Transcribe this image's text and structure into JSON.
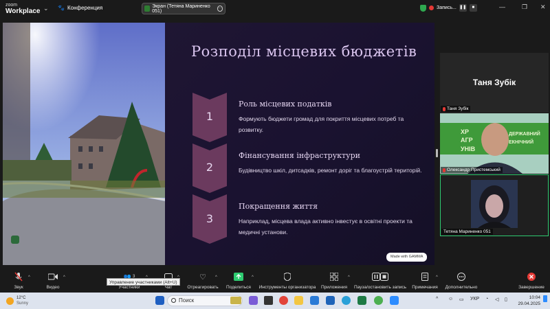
{
  "app": {
    "logo_line1": "zoom",
    "logo_line2": "Workplace",
    "meeting_label": "Конференция"
  },
  "screen_share": {
    "label": "Экран (Тетяна Мариненко 051)"
  },
  "recording": {
    "label": "Запись..."
  },
  "slide": {
    "title": "Розподіл місцевих бюджетів",
    "items": [
      {
        "num": "1",
        "heading": "Роль місцевих податків",
        "text": "Формують бюджети громад для покриття місцевих потреб та розвитку."
      },
      {
        "num": "2",
        "heading": "Фінансування інфраструктури",
        "text": "Будівництво шкіл, дитсадків, ремонт доріг та благоустрій територій."
      },
      {
        "num": "3",
        "heading": "Покращення життя",
        "text": "Наприклад, місцева влада активно інвестує в освітні проекти та медичні установи."
      }
    ],
    "badge": "Made with GAMMA"
  },
  "participants": [
    {
      "display": "Таня Зубік",
      "name": "Таня Зубік"
    },
    {
      "name": "Олександр Пристемський",
      "bg_text": "ХР ДЕРЖАВНИЙ АГР ЕКНІЧНИЙ УНІВ"
    },
    {
      "name": "Тетяна Мариненко 051"
    }
  ],
  "toolbar": {
    "items": [
      {
        "label": "Звук",
        "icon": "mic-muted-icon"
      },
      {
        "label": "Видео",
        "icon": "video-icon"
      },
      {
        "label": "Участники",
        "icon": "participants-icon",
        "count": "3"
      },
      {
        "label": "Чат",
        "icon": "chat-icon"
      },
      {
        "label": "Отреагировать",
        "icon": "heart-icon"
      },
      {
        "label": "Поделиться",
        "icon": "share-icon"
      },
      {
        "label": "Инструменты организатора",
        "icon": "shield-icon"
      },
      {
        "label": "Приложения",
        "icon": "apps-icon"
      },
      {
        "label": "Пауза/остановить запись",
        "icon": "pause-record-icon"
      },
      {
        "label": "Примечания",
        "icon": "notes-icon"
      },
      {
        "label": "Дополнительно",
        "icon": "more-icon"
      },
      {
        "label": "Завершение",
        "icon": "end-icon"
      }
    ],
    "tooltip": "Управление участниками (Alt+U)"
  },
  "taskbar": {
    "weather_temp": "12°C",
    "weather_desc": "Sunny",
    "search_placeholder": "Поиск",
    "language": "УКР",
    "time": "10:04",
    "date": "29.04.2025"
  },
  "colors": {
    "accent_green": "#2ecc71",
    "chevron": "#6b3a5e",
    "end_red": "#e53935"
  }
}
